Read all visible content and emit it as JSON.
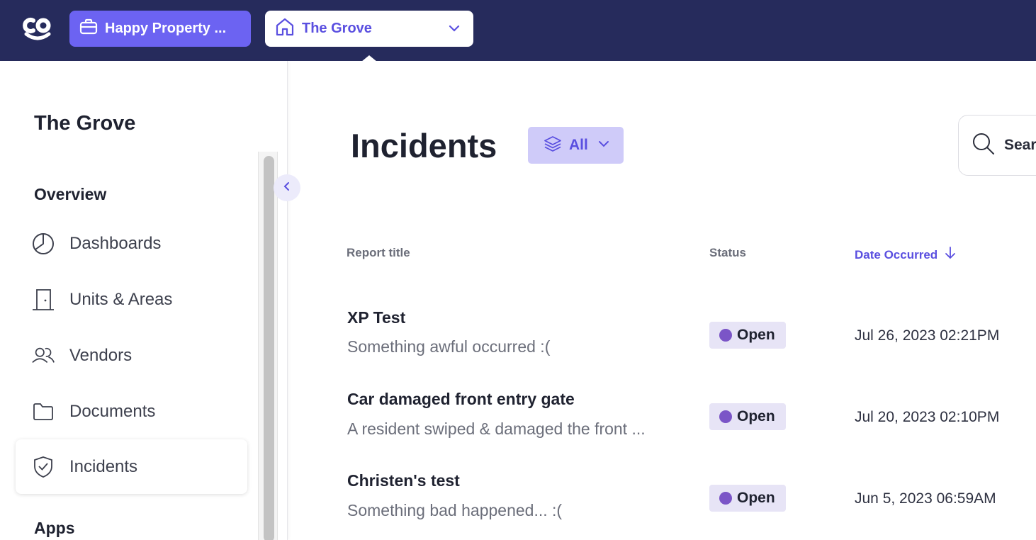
{
  "header": {
    "org_button_label": "Happy Property ...",
    "property_selector_label": "The Grove"
  },
  "sidebar": {
    "title": "The Grove",
    "overview_heading": "Overview",
    "items": [
      {
        "label": "Dashboards",
        "icon": "pie-chart-icon"
      },
      {
        "label": "Units & Areas",
        "icon": "door-icon"
      },
      {
        "label": "Vendors",
        "icon": "users-icon"
      },
      {
        "label": "Documents",
        "icon": "folder-icon"
      },
      {
        "label": "Incidents",
        "icon": "shield-check-icon",
        "active": true
      }
    ],
    "apps_heading": "Apps"
  },
  "main": {
    "title": "Incidents",
    "filter_label": "All",
    "search_placeholder": "Search",
    "columns": {
      "report_title": "Report title",
      "status": "Status",
      "date_occurred": "Date Occurred"
    },
    "rows": [
      {
        "title": "XP Test",
        "description": "Something awful occurred :(",
        "status": "Open",
        "date": "Jul 26, 2023 02:21PM"
      },
      {
        "title": "Car damaged front entry gate",
        "description": "A resident swiped & damaged the front ...",
        "status": "Open",
        "date": "Jul 20, 2023 02:10PM"
      },
      {
        "title": "Christen's test",
        "description": "Something bad happened... :(",
        "status": "Open",
        "date": "Jun 5, 2023 06:59AM"
      }
    ]
  },
  "colors": {
    "topbar": "#262b5c",
    "accent": "#6c63f2",
    "status_open_dot": "#7b55c7"
  }
}
